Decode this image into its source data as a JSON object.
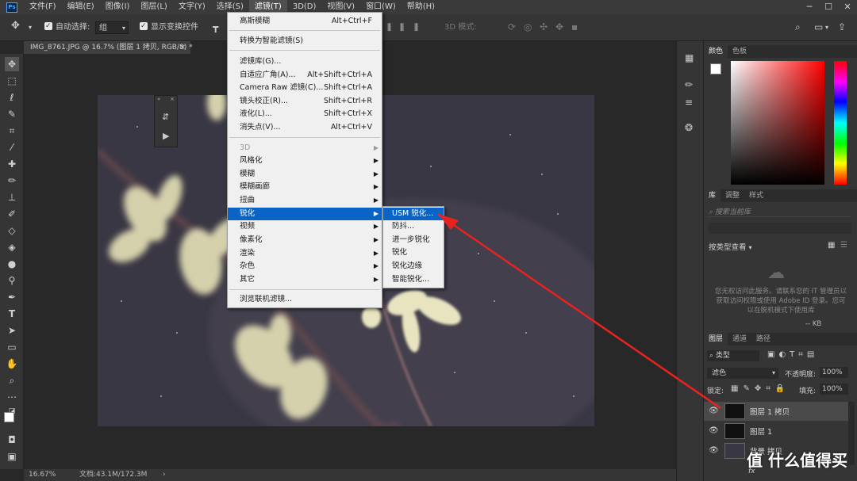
{
  "menubar": {
    "logo": "Ps",
    "items": [
      "文件(F)",
      "编辑(E)",
      "图像(I)",
      "图层(L)",
      "文字(Y)",
      "选择(S)",
      "滤镜(T)",
      "3D(D)",
      "视图(V)",
      "窗口(W)",
      "帮助(H)"
    ],
    "active_index": 6,
    "window_controls": [
      "─",
      "☐",
      "✕"
    ]
  },
  "options_bar": {
    "auto_select_label": "自动选择:",
    "auto_select_value": "组",
    "show_transform_label": "显示变换控件",
    "mode_3d_label": "3D 模式:"
  },
  "document": {
    "tab_title": "IMG_8761.JPG @ 16.7% (图层 1 拷贝, RGB/8) *",
    "close_symbol": "×"
  },
  "statusbar": {
    "zoom": "16.67%",
    "doc_info": "文档:43.1M/172.3M",
    "arrow": "›"
  },
  "filter_menu": {
    "items": [
      {
        "label": "高斯模糊",
        "shortcut": "Alt+Ctrl+F"
      },
      {
        "label": "转换为智能滤镜(S)",
        "shortcut": ""
      },
      {
        "label": "滤镜库(G)...",
        "shortcut": ""
      },
      {
        "label": "自适应广角(A)...",
        "shortcut": "Alt+Shift+Ctrl+A"
      },
      {
        "label": "Camera Raw 滤镜(C)...",
        "shortcut": "Shift+Ctrl+A"
      },
      {
        "label": "镜头校正(R)...",
        "shortcut": "Shift+Ctrl+R"
      },
      {
        "label": "液化(L)...",
        "shortcut": "Shift+Ctrl+X"
      },
      {
        "label": "消失点(V)...",
        "shortcut": "Alt+Ctrl+V"
      },
      {
        "label": "3D",
        "shortcut": ""
      },
      {
        "label": "风格化",
        "shortcut": ""
      },
      {
        "label": "模糊",
        "shortcut": ""
      },
      {
        "label": "模糊画廊",
        "shortcut": ""
      },
      {
        "label": "扭曲",
        "shortcut": ""
      },
      {
        "label": "锐化",
        "shortcut": ""
      },
      {
        "label": "视频",
        "shortcut": ""
      },
      {
        "label": "像素化",
        "shortcut": ""
      },
      {
        "label": "渲染",
        "shortcut": ""
      },
      {
        "label": "杂色",
        "shortcut": ""
      },
      {
        "label": "其它",
        "shortcut": ""
      },
      {
        "label": "浏览联机滤镜...",
        "shortcut": ""
      }
    ]
  },
  "sharpen_submenu": {
    "items": [
      "USM 锐化...",
      "防抖...",
      "进一步锐化",
      "锐化",
      "锐化边缘",
      "智能锐化..."
    ]
  },
  "color_panel": {
    "tabs": [
      "颜色",
      "色板"
    ]
  },
  "libraries_panel": {
    "tabs": [
      "库",
      "调整",
      "样式"
    ],
    "search_placeholder": "搜索当前库",
    "view_by": "按类型查看",
    "message": "您无权访问此服务。请联系您的 IT 管理员以获取访问权限或使用 Adobe ID 登录。您可以在脱机模式下使用库",
    "storage": "-- KB"
  },
  "layers_panel": {
    "tabs": [
      "图层",
      "通道",
      "路径"
    ],
    "filter_label": "类型",
    "blend_mode": "滤色",
    "opacity_label": "不透明度:",
    "opacity_value": "100%",
    "lock_label": "锁定:",
    "fill_label": "填充:",
    "fill_value": "100%",
    "layers": [
      {
        "name": "图层 1 拷贝",
        "selected": true
      },
      {
        "name": "图层 1",
        "selected": false
      },
      {
        "name": "背景 拷贝",
        "selected": false
      }
    ],
    "fx_label": "fx"
  },
  "watermark": "值 什么值得买",
  "colors": {
    "highlight": "#0a64c8",
    "annotation_arrow": "#e8231f"
  }
}
